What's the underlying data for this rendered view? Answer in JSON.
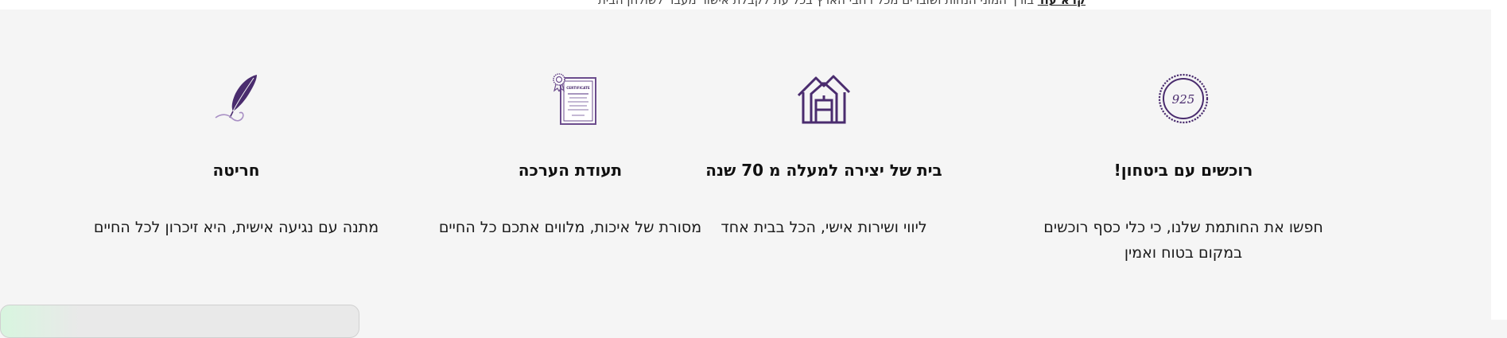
{
  "top_strip": {
    "text": "בורך המוני הנחות ושוברים מכל רחבי הארץ בכל עת לקבלת אישור מעבר לשולחן הבית",
    "link_label": "קרא עוד"
  },
  "features": [
    {
      "icon": "seal-925-icon",
      "title": "רוכשים עם ביטחון!",
      "description": "חפשו את החותמת שלנו, כי כלי כסף רוכשים במקום בטוח ואמין"
    },
    {
      "icon": "house-icon",
      "title": "בית של יצירה למעלה מ 70 שנה",
      "description": "ליווי ושירות אישי, הכל בבית אחד"
    },
    {
      "icon": "certificate-icon",
      "title": "תעודת הערכה",
      "description": "מסורת של איכות, מלווים אתכם כל החיים"
    },
    {
      "icon": "quill-icon",
      "title": "חריטה",
      "description": "מתנה עם נגיעה אישית, היא זיכרון לכל החיים"
    }
  ],
  "icon_labels": {
    "seal": "925",
    "certificate": "CERTIFICATE"
  },
  "colors": {
    "accent": "#4a2c6e",
    "background": "#f5f5f5"
  }
}
